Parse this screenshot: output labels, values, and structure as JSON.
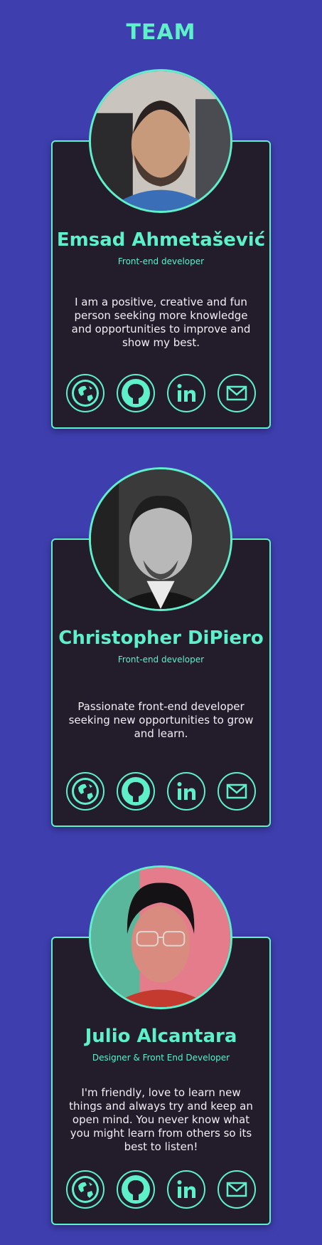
{
  "title": "TEAM",
  "colors": {
    "background": "#3e3eaf",
    "card": "#231c2b",
    "accent": "#5ef0c9",
    "text": "#f2eef5"
  },
  "members": [
    {
      "name": "Emsad Ahmetašević",
      "role": "Front-end developer",
      "bio": "I am a positive, creative and fun person seeking more knowledge and opportunities to improve and show my best.",
      "links": [
        "globe-icon",
        "github-icon",
        "linkedin-icon",
        "mail-icon"
      ]
    },
    {
      "name": "Christopher DiPiero",
      "role": "Front-end developer",
      "bio": "Passionate front-end developer seeking new opportunities to grow and learn.",
      "links": [
        "globe-icon",
        "github-icon",
        "linkedin-icon",
        "mail-icon"
      ]
    },
    {
      "name": "Julio Alcantara",
      "role": "Designer & Front End Developer",
      "bio": "I'm friendly, love to learn new things and always try and keep an open mind. You never know what you might learn from others so its best to listen!",
      "links": [
        "globe-icon",
        "github-icon",
        "linkedin-icon",
        "mail-icon"
      ]
    }
  ]
}
